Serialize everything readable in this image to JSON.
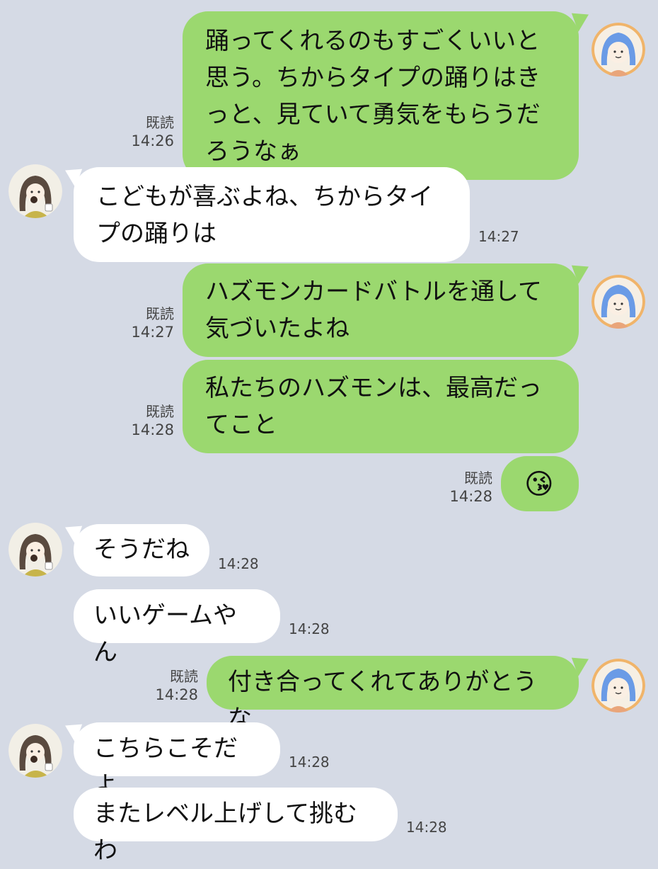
{
  "colors": {
    "background": "#d5dae5",
    "my_bubble": "#9bd86f",
    "their_bubble": "#ffffff"
  },
  "messages": [
    {
      "side": "me",
      "text": "踊ってくれるのもすごくいいと思う。ちからタイプの踊りはきっと、見ていて勇気をもらうだろうなぁ",
      "read": "既読",
      "time": "14:26"
    },
    {
      "side": "them",
      "text": "こどもが喜ぶよね、ちからタイプの踊りは",
      "time": "14:27"
    },
    {
      "side": "me",
      "text": "ハズモンカードバトルを通して気づいたよね",
      "read": "既読",
      "time": "14:27"
    },
    {
      "side": "me",
      "text": "私たちのハズモンは、最高だってこと",
      "read": "既読",
      "time": "14:28"
    },
    {
      "side": "me",
      "text": "😘",
      "read": "既読",
      "time": "14:28"
    },
    {
      "side": "them",
      "text": "そうだね",
      "time": "14:28"
    },
    {
      "side": "them",
      "text": "いいゲームやん",
      "time": "14:28"
    },
    {
      "side": "me",
      "text": "付き合ってくれてありがとうな",
      "read": "既読",
      "time": "14:28"
    },
    {
      "side": "them",
      "text": "こちらこそだよ",
      "time": "14:28"
    },
    {
      "side": "them",
      "text": "またレベル上げして挑むわ",
      "time": "14:28"
    }
  ]
}
